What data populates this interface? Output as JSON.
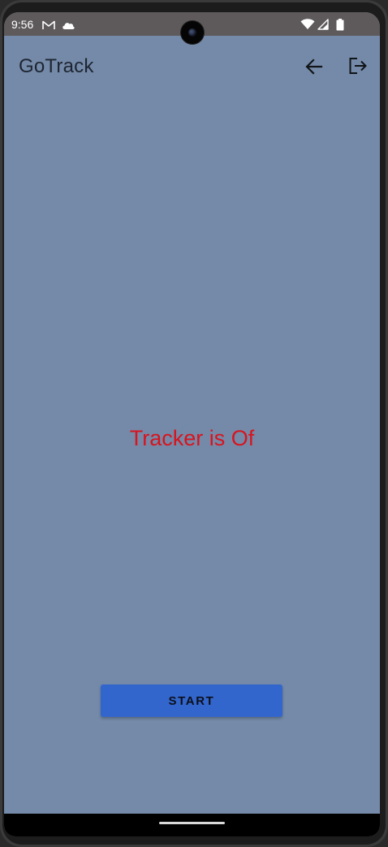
{
  "status_bar": {
    "time": "9:56",
    "icons": [
      "gmail-icon",
      "cloud-icon",
      "wifi-icon",
      "cell-signal-icon",
      "battery-icon"
    ]
  },
  "app_bar": {
    "title": "GoTrack",
    "back_icon": "arrow-back-icon",
    "logout_icon": "logout-icon"
  },
  "main": {
    "tracker_status": "Tracker is Of",
    "start_label": "START"
  },
  "colors": {
    "background": "#748aa8",
    "status_text": "#d8141e",
    "button": "#3366cc",
    "status_bar": "#5e5a5c"
  }
}
